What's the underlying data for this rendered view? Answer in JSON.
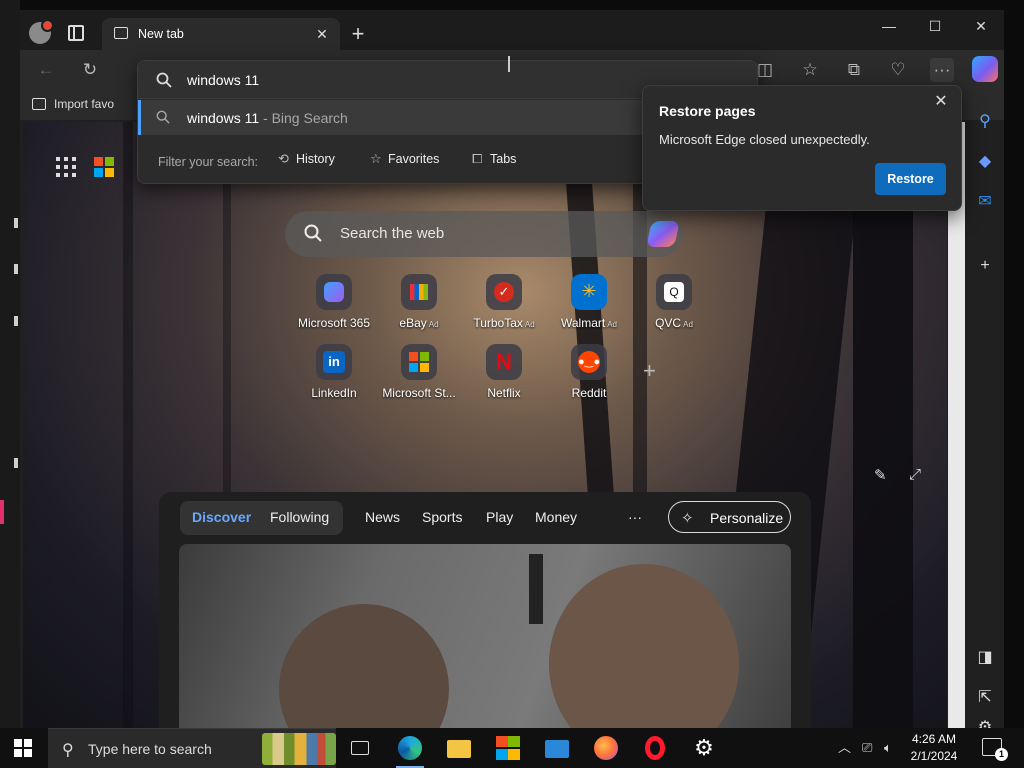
{
  "browser": {
    "tab_title": "New tab",
    "favorites_import": "Import favo"
  },
  "omnibox": {
    "value": "windows 11",
    "suggestion_main": "windows 11",
    "suggestion_sub": " - Bing Search",
    "filter_label": "Filter your search:",
    "filters": [
      "History",
      "Favorites",
      "Tabs"
    ]
  },
  "restore_dialog": {
    "title": "Restore pages",
    "message": "Microsoft Edge closed unexpectedly.",
    "button": "Restore"
  },
  "ntp": {
    "search_placeholder": "Search the web",
    "tiles_row1": [
      {
        "label": "Microsoft 365",
        "ad": ""
      },
      {
        "label": "eBay",
        "ad": "Ad"
      },
      {
        "label": "TurboTax",
        "ad": "Ad"
      },
      {
        "label": "Walmart",
        "ad": "Ad"
      },
      {
        "label": "QVC",
        "ad": "Ad"
      }
    ],
    "tiles_row2": [
      {
        "label": "LinkedIn"
      },
      {
        "label": "Microsoft St..."
      },
      {
        "label": "Netflix"
      },
      {
        "label": "Reddit"
      }
    ],
    "add_tile": "+"
  },
  "feed": {
    "tabs": [
      "Discover",
      "Following"
    ],
    "nav": [
      "News",
      "Sports",
      "Play",
      "Money"
    ],
    "more": "···",
    "personalize": "Personalize"
  },
  "taskbar": {
    "search_placeholder": "Type here to search",
    "time": "4:26 AM",
    "date": "2/1/2024",
    "notification_count": "1"
  },
  "colors": {
    "accent": "#0f6cbd",
    "suggestion_bar": "#4aa1ff",
    "discover_active": "#6aa8ff"
  }
}
